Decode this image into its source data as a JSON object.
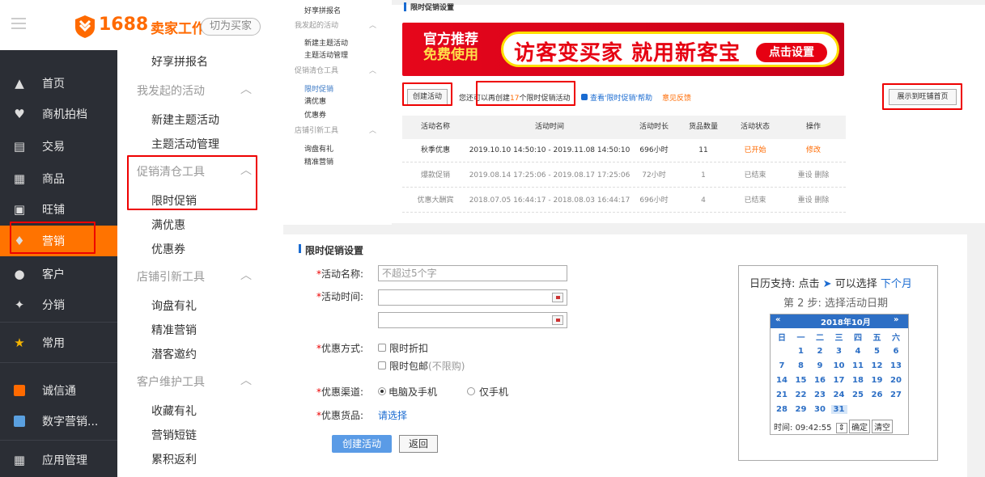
{
  "header": {
    "logo_number": "1688",
    "logo_title": "卖家工作台",
    "switch_label": "切为买家"
  },
  "sidebar": {
    "items": [
      {
        "label": "首页",
        "icon": "home-icon"
      },
      {
        "label": "商机拍档",
        "icon": "partner-icon"
      },
      {
        "label": "交易",
        "icon": "trade-icon"
      },
      {
        "label": "商品",
        "icon": "product-icon"
      },
      {
        "label": "旺铺",
        "icon": "shop-icon"
      },
      {
        "label": "营销",
        "icon": "tag-icon"
      },
      {
        "label": "客户",
        "icon": "user-icon"
      },
      {
        "label": "分销",
        "icon": "distribution-icon"
      },
      {
        "label": "常用",
        "icon": "star-icon"
      },
      {
        "label": "诚信通",
        "icon": "chengxintong-icon"
      },
      {
        "label": "数字营销...",
        "icon": "digital-marketing-icon"
      },
      {
        "label": "应用管理",
        "icon": "apps-icon"
      }
    ]
  },
  "subnav": {
    "items": [
      {
        "label": "好享拼报名",
        "type": "item"
      },
      {
        "label": "我发起的活动",
        "type": "group"
      },
      {
        "label": "新建主题活动",
        "type": "item"
      },
      {
        "label": "主题活动管理",
        "type": "item"
      },
      {
        "label": "促销清仓工具",
        "type": "group"
      },
      {
        "label": "限时促销",
        "type": "item"
      },
      {
        "label": "满优惠",
        "type": "item"
      },
      {
        "label": "优惠券",
        "type": "item"
      },
      {
        "label": "店铺引新工具",
        "type": "group"
      },
      {
        "label": "询盘有礼",
        "type": "item"
      },
      {
        "label": "精准营销",
        "type": "item"
      },
      {
        "label": "潜客邀约",
        "type": "item"
      },
      {
        "label": "客户维护工具",
        "type": "group"
      },
      {
        "label": "收藏有礼",
        "type": "item"
      },
      {
        "label": "营销短链",
        "type": "item"
      },
      {
        "label": "累积返利",
        "type": "item"
      }
    ]
  },
  "thumb_nav": {
    "items": [
      {
        "label": "好享拼报名",
        "type": "item"
      },
      {
        "label": "我发起的活动",
        "type": "group"
      },
      {
        "label": "新建主题活动",
        "type": "item"
      },
      {
        "label": "主题活动管理",
        "type": "item"
      },
      {
        "label": "促销清仓工具",
        "type": "group"
      },
      {
        "label": "限时促销",
        "type": "active"
      },
      {
        "label": "满优惠",
        "type": "item"
      },
      {
        "label": "优惠券",
        "type": "item"
      },
      {
        "label": "店铺引新工具",
        "type": "group"
      },
      {
        "label": "询盘有礼",
        "type": "item"
      },
      {
        "label": "精准营销",
        "type": "item"
      }
    ]
  },
  "promo_list": {
    "title": "限时促销设置",
    "banner": {
      "left_line1": "官方推荐",
      "left_line2": "免费使用",
      "main_text": "访客变买家 就用新客宝",
      "cta": "点击设置"
    },
    "create_button": "创建活动",
    "quota_prefix": "您还可以再创建",
    "quota_number": "17",
    "quota_suffix": "个限时促销活动",
    "help_link": "查看'限时促销'帮助",
    "feedback_link": "意见反馈",
    "shop_button": "展示到旺铺首页",
    "columns": [
      "活动名称",
      "活动时间",
      "活动时长",
      "货品数量",
      "活动状态",
      "操作"
    ],
    "rows": [
      {
        "name": "秋季优惠",
        "time": "2019.10.10 14:50:10 - 2019.11.08 14:50:10",
        "duration": "696小时",
        "count": "11",
        "status": "已开始",
        "status_color": "#ff6a00",
        "actions": "修改"
      },
      {
        "name": "爆款促销",
        "time": "2019.08.14 17:25:06 - 2019.08.17 17:25:06",
        "duration": "72小时",
        "count": "1",
        "status": "已结束",
        "status_color": "#999999",
        "actions": "重设 删除"
      },
      {
        "name": "优惠大酬宾",
        "time": "2018.07.05 16:44:17 - 2018.08.03 16:44:17",
        "duration": "696小时",
        "count": "4",
        "status": "已结束",
        "status_color": "#999999",
        "actions": "重设 删除"
      }
    ]
  },
  "form": {
    "title": "限时促销设置",
    "name_label": "活动名称:",
    "name_placeholder": "不超过5个字",
    "time_label": "活动时间:",
    "discount_label": "优惠方式:",
    "discount_opt1": "限时折扣",
    "discount_opt2": "限时包邮",
    "discount_opt2_note": "(不限购)",
    "channel_label": "优惠渠道:",
    "channel_opt1": "电脑及手机",
    "channel_opt2": "仅手机",
    "goods_label": "优惠货品:",
    "goods_link": "请选择",
    "submit": "创建活动",
    "back": "返回"
  },
  "calendar_help": {
    "tip_prefix": "日历支持: 点击",
    "tip_mid": "可以选择",
    "tip_link": "下个月",
    "step": "第 2 步: 选择活动日期",
    "prev": "«",
    "next": "»",
    "month": "2018年10月",
    "weekdays": [
      "日",
      "一",
      "二",
      "三",
      "四",
      "五",
      "六"
    ],
    "weeks": [
      [
        "",
        "1",
        "2",
        "3",
        "4",
        "5",
        "6"
      ],
      [
        "7",
        "8",
        "9",
        "10",
        "11",
        "12",
        "13"
      ],
      [
        "14",
        "15",
        "16",
        "17",
        "18",
        "19",
        "20"
      ],
      [
        "21",
        "22",
        "23",
        "24",
        "25",
        "26",
        "27"
      ],
      [
        "28",
        "29",
        "30",
        "31",
        "",
        "",
        ""
      ]
    ],
    "time_label": "时间:",
    "time_value": "09:42:55",
    "ok": "确定",
    "clear": "清空"
  },
  "colors": {
    "brand": "#ff6a00",
    "sidebar_bg": "#2b2e35",
    "active": "#ff7300",
    "highlight_box": "#e00000",
    "link": "#1a6bd1"
  }
}
